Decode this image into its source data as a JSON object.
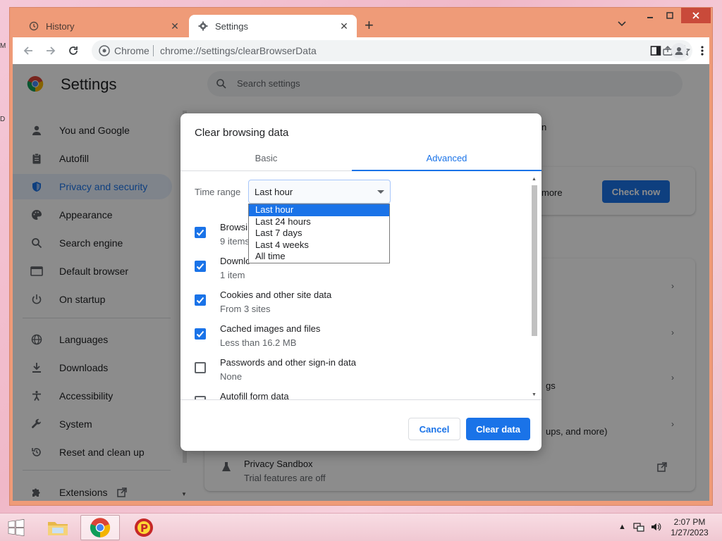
{
  "browser": {
    "tabs": [
      {
        "label": "History",
        "icon": "history-icon",
        "active": false
      },
      {
        "label": "Settings",
        "icon": "gear-icon",
        "active": true
      }
    ],
    "omnibox": {
      "site_label": "Chrome",
      "url": "chrome://settings/clearBrowserData"
    }
  },
  "settings": {
    "title": "Settings",
    "search_placeholder": "Search settings",
    "sidebar": [
      {
        "label": "You and Google",
        "icon": "person-icon"
      },
      {
        "label": "Autofill",
        "icon": "clipboard-icon"
      },
      {
        "label": "Privacy and security",
        "icon": "shield-icon",
        "selected": true
      },
      {
        "label": "Appearance",
        "icon": "palette-icon"
      },
      {
        "label": "Search engine",
        "icon": "search-icon"
      },
      {
        "label": "Default browser",
        "icon": "browser-icon"
      },
      {
        "label": "On startup",
        "icon": "power-icon"
      },
      {
        "label": "Languages",
        "icon": "globe-icon"
      },
      {
        "label": "Downloads",
        "icon": "download-icon"
      },
      {
        "label": "Accessibility",
        "icon": "accessibility-icon"
      },
      {
        "label": "System",
        "icon": "wrench-icon"
      },
      {
        "label": "Reset and clean up",
        "icon": "reset-icon"
      },
      {
        "label": "Extensions",
        "icon": "puzzle-icon"
      }
    ],
    "background": {
      "snippet_n": "n",
      "snippet_more": "more",
      "check_now": "Check now",
      "snippet_gs": "gs",
      "snippet_ups": "ups, and more)",
      "privacy_sandbox_title": "Privacy Sandbox",
      "privacy_sandbox_sub": "Trial features are off"
    }
  },
  "dialog": {
    "title": "Clear browsing data",
    "tabs": [
      {
        "label": "Basic"
      },
      {
        "label": "Advanced",
        "active": true
      }
    ],
    "time_range_label": "Time range",
    "time_range_value": "Last hour",
    "time_range_options": [
      "Last hour",
      "Last 24 hours",
      "Last 7 days",
      "Last 4 weeks",
      "All time"
    ],
    "items": [
      {
        "title": "Browsi",
        "sub": "9 items",
        "checked": true
      },
      {
        "title": "Downlo",
        "sub": "1 item",
        "checked": true
      },
      {
        "title": "Cookies and other site data",
        "sub": "From 3 sites",
        "checked": true
      },
      {
        "title": "Cached images and files",
        "sub": "Less than 16.2 MB",
        "checked": true
      },
      {
        "title": "Passwords and other sign-in data",
        "sub": "None",
        "checked": false
      },
      {
        "title": "Autofill form data",
        "sub": "",
        "checked": false
      }
    ],
    "cancel_label": "Cancel",
    "clear_label": "Clear data"
  },
  "taskbar": {
    "time": "2:07 PM",
    "date": "1/27/2023"
  },
  "colors": {
    "accent": "#1a73e8",
    "window_frame": "#ef9b78"
  }
}
